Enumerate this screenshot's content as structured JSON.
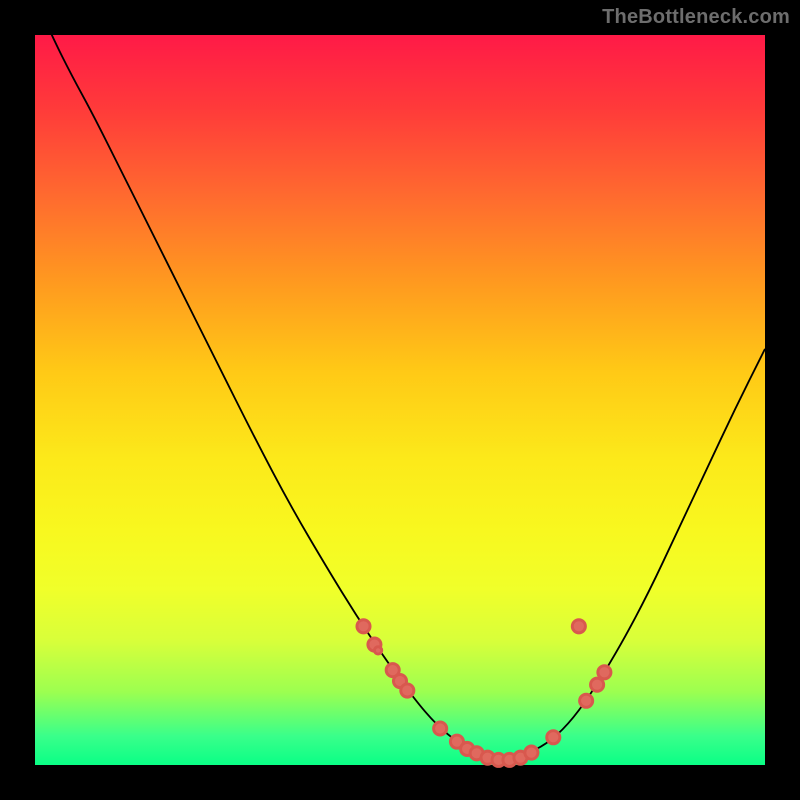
{
  "watermark": "TheBottleneck.com",
  "colors": {
    "point_fill": "#e0695e",
    "curve_stroke": "#000000"
  },
  "chart_data": {
    "type": "line",
    "title": "",
    "xlabel": "",
    "ylabel": "",
    "xlim": [
      0,
      100
    ],
    "ylim": [
      0,
      100
    ],
    "note": "Values are in plot-area percent coordinates (0–100). y=0 is top of the gradient, y=100 is bottom.",
    "curve": [
      {
        "x": 0.0,
        "y": -5.0
      },
      {
        "x": 2.5,
        "y": 0.5
      },
      {
        "x": 5.0,
        "y": 5.5
      },
      {
        "x": 8.0,
        "y": 11.0
      },
      {
        "x": 12.0,
        "y": 19.0
      },
      {
        "x": 16.0,
        "y": 27.0
      },
      {
        "x": 20.0,
        "y": 35.0
      },
      {
        "x": 25.0,
        "y": 45.0
      },
      {
        "x": 30.0,
        "y": 55.0
      },
      {
        "x": 35.0,
        "y": 64.5
      },
      {
        "x": 40.0,
        "y": 73.0
      },
      {
        "x": 44.0,
        "y": 79.5
      },
      {
        "x": 48.0,
        "y": 85.5
      },
      {
        "x": 52.0,
        "y": 91.0
      },
      {
        "x": 55.0,
        "y": 94.5
      },
      {
        "x": 58.0,
        "y": 97.0
      },
      {
        "x": 61.0,
        "y": 98.6
      },
      {
        "x": 64.0,
        "y": 99.2
      },
      {
        "x": 67.0,
        "y": 98.6
      },
      {
        "x": 70.0,
        "y": 97.2
      },
      {
        "x": 73.0,
        "y": 94.5
      },
      {
        "x": 76.0,
        "y": 90.5
      },
      {
        "x": 80.0,
        "y": 84.0
      },
      {
        "x": 84.0,
        "y": 76.5
      },
      {
        "x": 88.0,
        "y": 68.0
      },
      {
        "x": 92.0,
        "y": 59.5
      },
      {
        "x": 96.0,
        "y": 51.0
      },
      {
        "x": 100.0,
        "y": 43.0
      }
    ],
    "points": [
      {
        "x": 45.0,
        "y": 81.0,
        "r": 0.9
      },
      {
        "x": 46.5,
        "y": 83.5,
        "r": 0.9
      },
      {
        "x": 47.0,
        "y": 84.3,
        "r": 0.5
      },
      {
        "x": 49.0,
        "y": 87.0,
        "r": 0.9
      },
      {
        "x": 50.0,
        "y": 88.5,
        "r": 0.9
      },
      {
        "x": 51.0,
        "y": 89.8,
        "r": 0.9
      },
      {
        "x": 55.5,
        "y": 95.0,
        "r": 0.9
      },
      {
        "x": 57.8,
        "y": 96.8,
        "r": 0.9
      },
      {
        "x": 59.2,
        "y": 97.8,
        "r": 0.9
      },
      {
        "x": 60.5,
        "y": 98.4,
        "r": 0.9
      },
      {
        "x": 62.0,
        "y": 99.0,
        "r": 0.9
      },
      {
        "x": 63.5,
        "y": 99.3,
        "r": 0.9
      },
      {
        "x": 65.0,
        "y": 99.3,
        "r": 0.9
      },
      {
        "x": 66.5,
        "y": 99.0,
        "r": 0.9
      },
      {
        "x": 68.0,
        "y": 98.3,
        "r": 0.9
      },
      {
        "x": 71.0,
        "y": 96.2,
        "r": 0.9
      },
      {
        "x": 75.5,
        "y": 91.2,
        "r": 0.9
      },
      {
        "x": 77.0,
        "y": 89.0,
        "r": 0.9
      },
      {
        "x": 78.0,
        "y": 87.3,
        "r": 0.9
      },
      {
        "x": 74.5,
        "y": 81.0,
        "r": 0.9
      }
    ]
  }
}
